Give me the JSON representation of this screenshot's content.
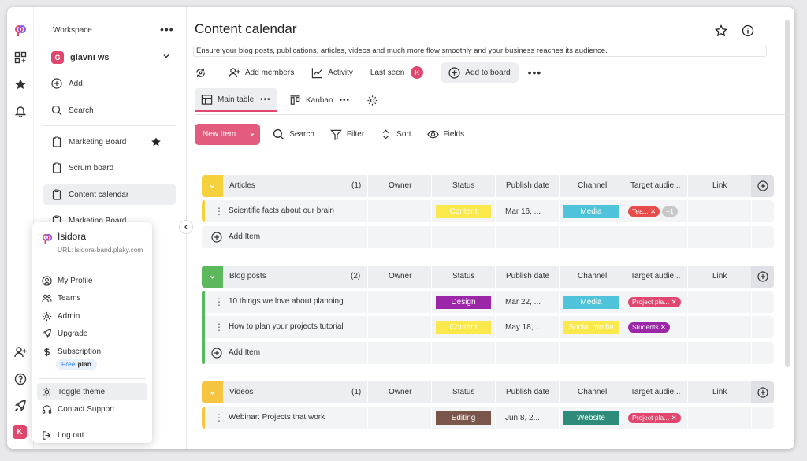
{
  "workspace": {
    "label": "Workspace",
    "name": "glavni ws",
    "badge": "G",
    "add": "Add",
    "search": "Search"
  },
  "boards": [
    {
      "label": "Marketing Board",
      "starred": true
    },
    {
      "label": "Scrum board",
      "starred": false
    },
    {
      "label": "Content calendar",
      "starred": false,
      "active": true
    },
    {
      "label": "Marketing Board",
      "starred": false
    }
  ],
  "rail": {
    "user_initial": "K"
  },
  "page": {
    "title": "Content calendar",
    "description": "Ensure your blog posts, publications, articles, videos and much more flow smoothly and your business reaches its audience."
  },
  "toolbar": {
    "add_members": "Add members",
    "activity": "Activity",
    "last_seen": "Last seen",
    "last_seen_initial": "K",
    "add_to_board": "Add to board"
  },
  "views": {
    "main_table": "Main table",
    "kanban": "Kanban"
  },
  "actions": {
    "new_item": "New Item",
    "search": "Search",
    "filter": "Filter",
    "sort": "Sort",
    "fields": "Fields"
  },
  "columns": {
    "owner": "Owner",
    "status": "Status",
    "publish_date": "Publish date",
    "channel": "Channel",
    "target": "Target audie...",
    "link": "Link"
  },
  "add_item_label": "Add Item",
  "colors": {
    "accent": "#e0466e",
    "articles": "#f5d13c",
    "blog": "#5cb85c",
    "videos": "#f5c542"
  },
  "groups": [
    {
      "name": "Articles",
      "count": "(1)",
      "color": "#f5d13c",
      "rows": [
        {
          "name": "Scientific facts about our brain",
          "status": "Content",
          "status_color": "#fbe84a",
          "date": "Mar 16, ...",
          "channel": "Media",
          "channel_color": "#4fc3d9",
          "tags": [
            {
              "label": "Tea... ✕",
              "color": "#e84b4b"
            },
            {
              "label": "+1",
              "color": "#c8c8c8"
            }
          ]
        }
      ]
    },
    {
      "name": "Blog posts",
      "count": "(2)",
      "color": "#5cb85c",
      "rows": [
        {
          "name": "10 things we love about planning",
          "status": "Design",
          "status_color": "#9b27a8",
          "date": "Mar 22, ...",
          "channel": "Media",
          "channel_color": "#4fc3d9",
          "tags": [
            {
              "label": "Project pla... ✕",
              "color": "#e0466e"
            }
          ]
        },
        {
          "name": "How to plan your projects tutorial",
          "status": "Content",
          "status_color": "#fbe84a",
          "date": "May 18, ...",
          "channel": "Social media",
          "channel_color": "#fbe84a",
          "tags": [
            {
              "label": "Students ✕",
              "color": "#9b27a8"
            }
          ]
        }
      ]
    },
    {
      "name": "Videos",
      "count": "(1)",
      "color": "#f5c542",
      "rows": [
        {
          "name": "Webinar: Projects that work",
          "status": "Editing",
          "status_color": "#7a5549",
          "date": "Jun 8, 2...",
          "channel": "Website",
          "channel_color": "#2e8b7a",
          "tags": [
            {
              "label": "Project pla... ✕",
              "color": "#e0466e"
            }
          ]
        }
      ]
    }
  ],
  "profile_menu": {
    "name": "Isidora",
    "url": "URL: isidora-band.plaky.com",
    "items": [
      "My Profile",
      "Teams",
      "Admin",
      "Upgrade",
      "Subscription"
    ],
    "plan_free": "Free",
    "plan_word": "plan",
    "toggle_theme": "Toggle theme",
    "contact_support": "Contact Support",
    "log_out": "Log out"
  }
}
